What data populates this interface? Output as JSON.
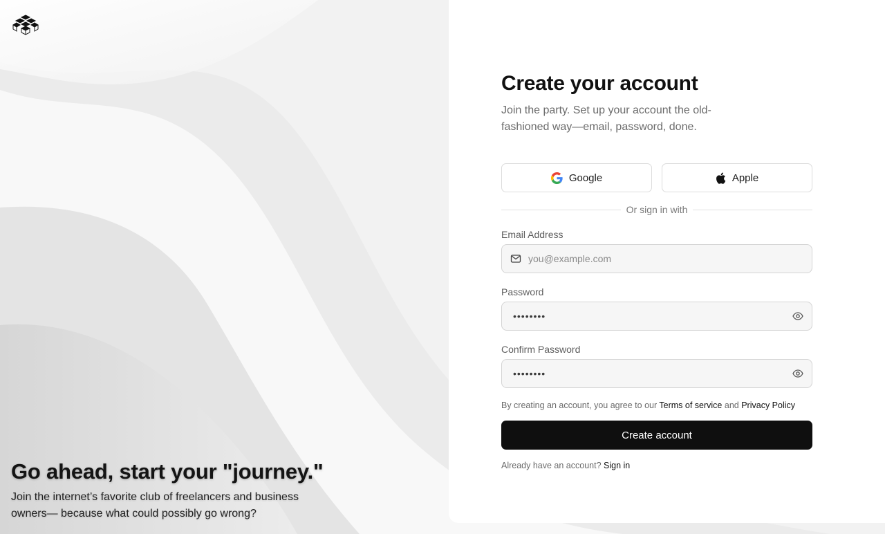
{
  "brand": {
    "logo_icon": "stacked-cubes-icon"
  },
  "hero": {
    "title": "Go ahead, start your \"journey.\"",
    "subtitle": "Join the internet’s favorite club of freelancers and business owners— because what could possibly go wrong?"
  },
  "form": {
    "title": "Create your account",
    "subtitle": "Join the party. Set up your account the old-fashioned way—email, password, done.",
    "social": {
      "google_label": "Google",
      "apple_label": "Apple"
    },
    "divider_text": "Or sign in with",
    "email": {
      "label": "Email Address",
      "placeholder": "you@example.com",
      "icon": "mail-icon"
    },
    "password": {
      "label": "Password",
      "masked_value": "••••••••",
      "icon": "eye-icon"
    },
    "confirm_password": {
      "label": "Confirm Password",
      "masked_value": "••••••••",
      "icon": "eye-icon"
    },
    "terms": {
      "prefix": "By creating an account, you agree to our",
      "terms_link": "Terms of service",
      "and": "and",
      "privacy_link": "Privacy Policy"
    },
    "submit_label": "Create account",
    "signin": {
      "prefix": "Already have an account?",
      "link": "Sign in"
    }
  },
  "colors": {
    "primary_button": "#0f0f0f",
    "background": "#ffffff",
    "field_background": "#f6f6f6"
  }
}
